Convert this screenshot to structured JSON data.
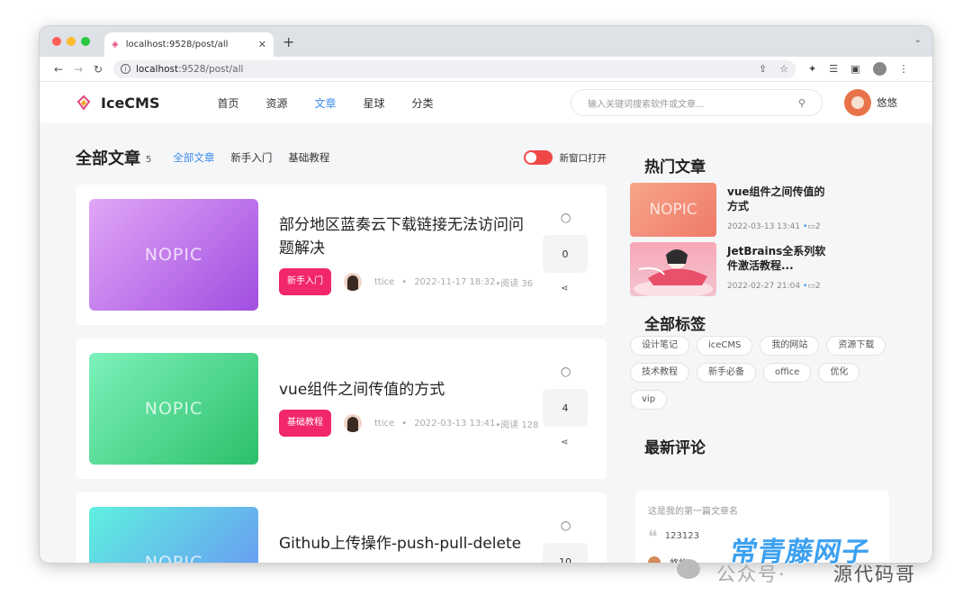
{
  "browser": {
    "tab_title": "localhost:9528/post/all",
    "url_host": "localhost",
    "url_path": ":9528/post/all",
    "new_tab": "+"
  },
  "header": {
    "logo_text": "IceCMS",
    "nav": [
      {
        "label": "首页"
      },
      {
        "label": "资源"
      },
      {
        "label": "文章",
        "active": true
      },
      {
        "label": "星球"
      },
      {
        "label": "分类"
      }
    ],
    "search_placeholder": "输入关键词搜索软件或文章...",
    "username": "悠悠"
  },
  "filter": {
    "title": "全部文章",
    "count": "5",
    "tabs": [
      "全部文章",
      "新手入门",
      "基础教程"
    ],
    "toggle_label": "新窗口打开"
  },
  "articles": [
    {
      "thumb_text": "NOPIC",
      "title": "部分地区蓝奏云下载链接无法访问问题解决",
      "badge": "新手入门",
      "author": "ttice",
      "date": "2022-11-17 18:32",
      "reads": "•阅读 36",
      "comments": "0",
      "gradient": [
        "#e2a6f7",
        "#a04ee0"
      ]
    },
    {
      "thumb_text": "NOPIC",
      "title": "vue组件之间传值的方式",
      "badge": "基础教程",
      "author": "ttice",
      "date": "2022-03-13 13:41",
      "reads": "•阅读 128",
      "comments": "4",
      "gradient": [
        "#7cf2bb",
        "#2dbf6a"
      ]
    },
    {
      "thumb_text": "NOPIC",
      "title": "Github上传操作-push-pull-delete",
      "comments": "10",
      "gradient": [
        "#5ff0e0",
        "#6a8cf5"
      ]
    }
  ],
  "sidebar": {
    "hot_title": "热门文章",
    "hot": [
      {
        "thumb_text": "NOPIC",
        "title": "vue组件之间传值的方式",
        "date": "2022-03-13 13:41",
        "comments": "2"
      },
      {
        "title": "JetBrains全系列软件激活教程...",
        "date": "2022-02-27 21:04",
        "comments": "2"
      }
    ],
    "tags_title": "全部标签",
    "tags": [
      "设计笔记",
      "iceCMS",
      "我的网站",
      "资源下载",
      "技术教程",
      "新手必备",
      "office",
      "优化",
      "vip"
    ],
    "comments_title": "最新评论",
    "latest_comment": {
      "article": "这是我的第一篇文章名",
      "text": "123123",
      "user": "悠悠"
    }
  },
  "watermark": {
    "gzh": "公众号·",
    "brand": "常青藤网子",
    "code": "源代码哥"
  }
}
